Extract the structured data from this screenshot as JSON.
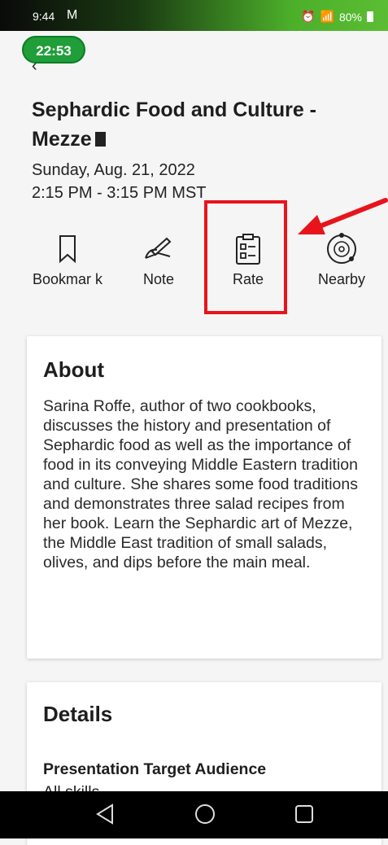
{
  "status_bar": {
    "time": "9:44",
    "battery": "80%"
  },
  "timer": "22:53",
  "session": {
    "title": "Sephardic Food and Culture - Mezze",
    "date": "Sunday, Aug. 21, 2022",
    "time_range": "2:15 PM - 3:15 PM MST"
  },
  "actions": [
    {
      "label": "Bookmar k",
      "icon": "bookmark-icon"
    },
    {
      "label": "Note",
      "icon": "pen-hand-icon"
    },
    {
      "label": "Rate",
      "icon": "clipboard-icon"
    },
    {
      "label": "Nearby",
      "icon": "radar-icon"
    }
  ],
  "about": {
    "heading": "About",
    "text": "Sarina Roffe, author of two cookbooks, discusses the history and presentation of Sephardic food as well as the importance of food in its conveying Middle Eastern tradition and culture. She shares some food traditions and demonstrates three salad recipes from her book. Learn the Sephardic art of Mezze, the Middle East tradition of small salads, olives, and dips before the main meal."
  },
  "details": {
    "heading": "Details",
    "audience_label": "Presentation Target Audience",
    "audience_value": "All skills"
  },
  "colors": {
    "accent": "#1f9e3a",
    "highlight": "#e8141c"
  }
}
